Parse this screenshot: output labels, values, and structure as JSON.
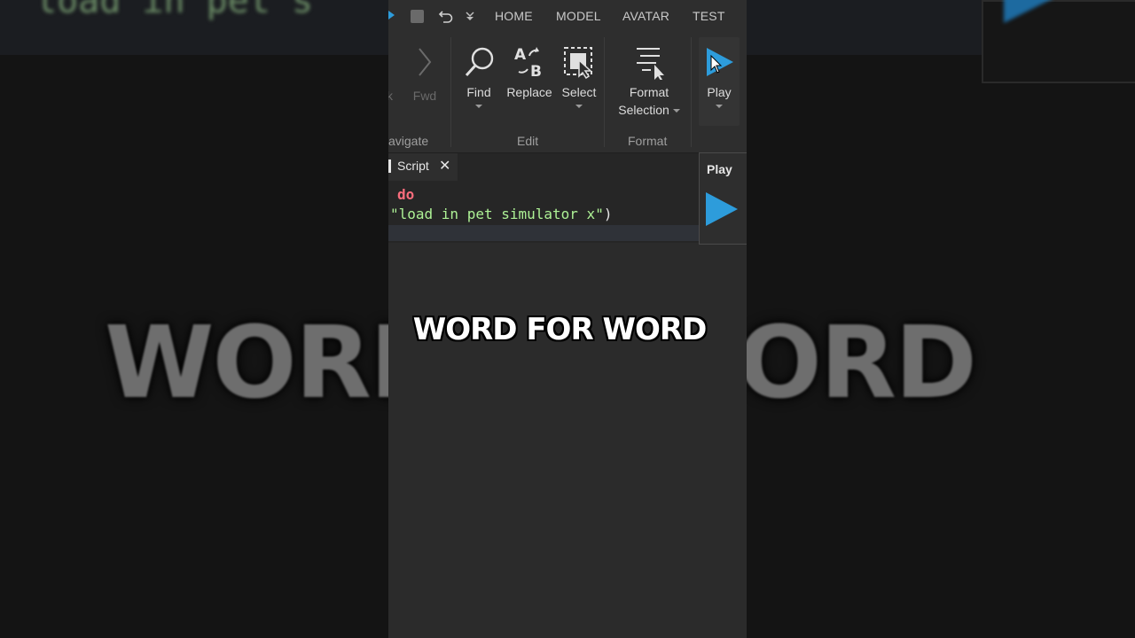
{
  "background": {
    "left_big_text": "WORD",
    "right_big_text": "ORD",
    "left_top_code": "load in pet s"
  },
  "topbar": {
    "tabs": [
      "HOME",
      "MODEL",
      "AVATAR",
      "TEST"
    ]
  },
  "ribbon": {
    "back_label": "k",
    "fwd_label": "Fwd",
    "find_label": "Find",
    "replace_label": "Replace",
    "select_label": "Select",
    "format_label_1": "Format",
    "format_label_2": "Selection",
    "play_label": "Play",
    "groups": {
      "navigate": "avigate",
      "edit": "Edit",
      "format": "Format"
    }
  },
  "editor": {
    "tab_name": "Script",
    "close_glyph": "✕",
    "line1": "do",
    "line2_string": "\"load in pet simulator x\"",
    "line2_paren": ")"
  },
  "play_popup": {
    "title": "Play"
  },
  "caption": "WORD FOR WORD",
  "colors": {
    "accent_blue": "#2d9cdb",
    "keyword": "#f86d7c",
    "string": "#adf195",
    "panel": "#2e2e2e"
  },
  "icons": [
    "stop-icon",
    "undo-icon",
    "more-icon",
    "forward-icon",
    "find-icon",
    "replace-icon",
    "select-icon",
    "format-icon",
    "play-icon",
    "close-icon",
    "pointer-icon"
  ]
}
